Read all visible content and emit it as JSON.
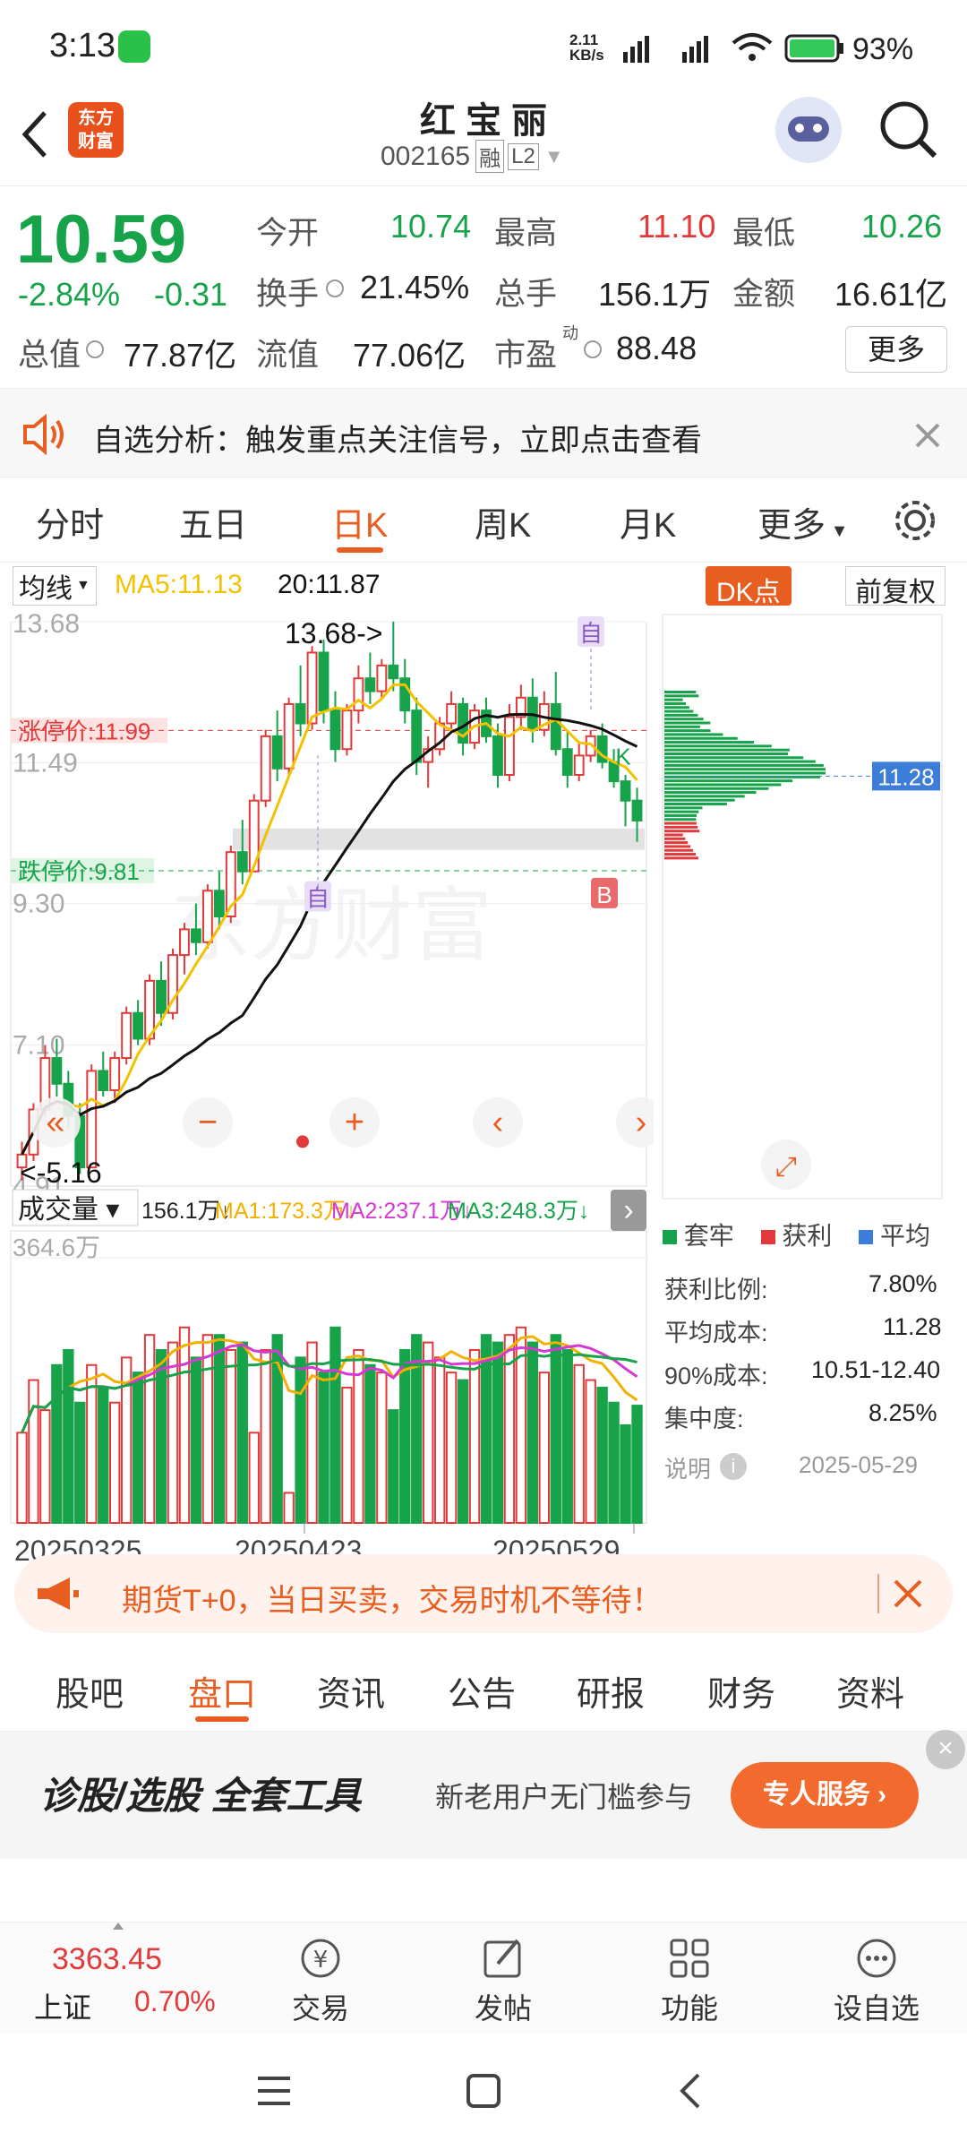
{
  "status_bar": {
    "time": "3:13",
    "net_speed_top": "2.11",
    "net_speed_unit": "KB/s",
    "battery": "93%"
  },
  "header": {
    "logo_line1": "东方",
    "logo_line2": "财富",
    "title": "红 宝 丽",
    "code": "002165",
    "badge1": "融",
    "badge2": "L2"
  },
  "quote": {
    "price": "10.59",
    "change_pct": "-2.84%",
    "change": "-0.31",
    "open_label": "今开",
    "open": "10.74",
    "high_label": "最高",
    "high": "11.10",
    "low_label": "最低",
    "low": "10.26",
    "turnover_label": "换手",
    "turnover": "21.45%",
    "volume_label": "总手",
    "volume": "156.1万",
    "amount_label": "金额",
    "amount": "16.61亿",
    "mktcap_label": "总值",
    "mktcap": "77.87亿",
    "float_label": "流值",
    "float": "77.06亿",
    "pe_label": "市盈",
    "pe_sup": "动",
    "pe": "88.48",
    "more_button": "更多"
  },
  "notice": {
    "text": "自选分析：触发重点关注信号，立即点击查看"
  },
  "tabs": [
    "分时",
    "五日",
    "日K",
    "周K",
    "月K",
    "更多"
  ],
  "active_tab": "日K",
  "chart_toolbar": {
    "ma_select": "均线",
    "ma5": "MA5:11.13",
    "ma20": "20:11.87",
    "dk_button": "DK点",
    "fq_button": "前复权"
  },
  "chart_data": {
    "type": "candlestick",
    "y_ticks": [
      "13.68",
      "11.49",
      "9.30",
      "7.10",
      "4.91"
    ],
    "limit_up_label": "涨停价:11.99",
    "limit_down_label": "跌停价:9.81",
    "max_annotation": "13.68->",
    "min_annotation": "<-5.16",
    "watermark": "东方财富",
    "markers": [
      "自",
      "自",
      "K",
      "B"
    ],
    "ohlc": [
      [
        5.2,
        5.6,
        5.0,
        5.4
      ],
      [
        5.4,
        6.2,
        5.3,
        6.1
      ],
      [
        6.1,
        7.1,
        6.0,
        6.9
      ],
      [
        6.9,
        7.2,
        6.3,
        6.5
      ],
      [
        6.5,
        6.7,
        5.8,
        6.0
      ],
      [
        6.0,
        6.2,
        5.1,
        5.2
      ],
      [
        5.2,
        6.8,
        5.2,
        6.7
      ],
      [
        6.7,
        7.0,
        6.3,
        6.4
      ],
      [
        6.4,
        7.0,
        6.2,
        6.9
      ],
      [
        6.9,
        7.7,
        6.8,
        7.6
      ],
      [
        7.6,
        7.8,
        7.1,
        7.2
      ],
      [
        7.2,
        8.2,
        7.1,
        8.1
      ],
      [
        8.1,
        8.4,
        7.4,
        7.6
      ],
      [
        7.6,
        8.6,
        7.5,
        8.5
      ],
      [
        8.5,
        9.0,
        8.2,
        8.9
      ],
      [
        8.9,
        9.3,
        8.5,
        8.7
      ],
      [
        8.7,
        9.6,
        8.6,
        9.5
      ],
      [
        9.5,
        9.8,
        8.9,
        9.1
      ],
      [
        9.1,
        10.2,
        9.0,
        10.1
      ],
      [
        10.1,
        10.6,
        9.6,
        9.8
      ],
      [
        9.8,
        11.0,
        9.8,
        10.9
      ],
      [
        10.9,
        12.0,
        10.8,
        11.9
      ],
      [
        11.9,
        12.3,
        11.2,
        11.4
      ],
      [
        11.4,
        12.5,
        11.3,
        12.4
      ],
      [
        12.4,
        13.0,
        11.9,
        12.1
      ],
      [
        12.1,
        13.3,
        12.0,
        13.2
      ],
      [
        13.2,
        13.4,
        12.1,
        12.3
      ],
      [
        12.3,
        12.6,
        11.5,
        11.7
      ],
      [
        11.7,
        12.4,
        11.6,
        12.3
      ],
      [
        12.3,
        13.0,
        12.1,
        12.8
      ],
      [
        12.8,
        13.2,
        12.4,
        12.6
      ],
      [
        12.6,
        13.1,
        12.5,
        13.0
      ],
      [
        13.0,
        13.68,
        12.6,
        12.8
      ],
      [
        12.8,
        13.1,
        12.1,
        12.3
      ],
      [
        12.3,
        12.5,
        11.3,
        11.5
      ],
      [
        11.5,
        11.9,
        11.1,
        11.7
      ],
      [
        11.7,
        12.2,
        11.6,
        12.1
      ],
      [
        12.1,
        12.6,
        12.0,
        12.4
      ],
      [
        12.4,
        12.5,
        11.6,
        11.8
      ],
      [
        11.8,
        12.4,
        11.7,
        12.3
      ],
      [
        12.3,
        12.5,
        11.8,
        11.9
      ],
      [
        11.9,
        12.1,
        11.1,
        11.3
      ],
      [
        11.3,
        12.4,
        11.2,
        12.2
      ],
      [
        12.2,
        12.7,
        12.0,
        12.5
      ],
      [
        12.5,
        12.8,
        11.8,
        12.0
      ],
      [
        12.0,
        12.6,
        11.9,
        12.4
      ],
      [
        12.4,
        12.9,
        11.6,
        11.7
      ],
      [
        11.7,
        12.0,
        11.1,
        11.3
      ],
      [
        11.3,
        11.8,
        11.2,
        11.6
      ],
      [
        11.6,
        12.0,
        11.5,
        11.9
      ],
      [
        11.9,
        12.1,
        11.4,
        11.5
      ],
      [
        11.5,
        11.7,
        11.1,
        11.2
      ],
      [
        11.2,
        11.3,
        10.5,
        10.9
      ],
      [
        10.9,
        11.1,
        10.26,
        10.59
      ]
    ],
    "volume_header": {
      "select": "成交量",
      "vol": "156.1万",
      "ma1": "MA1:173.3万",
      "ma2": "MA2:237.1万",
      "ma3": "MA3:248.3万"
    },
    "volume_max_label": "364.6万",
    "dates": [
      "20250325",
      "20250423",
      "20250529"
    ],
    "volume_values": [
      120,
      190,
      150,
      210,
      230,
      160,
      210,
      180,
      160,
      220,
      200,
      250,
      230,
      240,
      260,
      220,
      250,
      250,
      230,
      240,
      120,
      230,
      250,
      40,
      220,
      240,
      200,
      260,
      180,
      230,
      210,
      200,
      150,
      230,
      250,
      240,
      220,
      200,
      190,
      230,
      250,
      240,
      250,
      260,
      240,
      200,
      250,
      230,
      210,
      190,
      180,
      160,
      130,
      156
    ],
    "chip_panel": {
      "avg_price_label": "11.28",
      "legend": [
        "套牢",
        "获利",
        "平均"
      ],
      "profit_ratio_label": "获利比例:",
      "profit_ratio": "7.80%",
      "avg_cost_label": "平均成本:",
      "avg_cost": "11.28",
      "cost90_label": "90%成本:",
      "cost90": "10.51-12.40",
      "concentration_label": "集中度:",
      "concentration": "8.25%",
      "note_label": "说明",
      "date": "2025-05-29"
    }
  },
  "banner": {
    "text": "期货T+0，当日买卖，交易时机不等待！"
  },
  "subtabs": [
    "股吧",
    "盘口",
    "资讯",
    "公告",
    "研报",
    "财务",
    "资料"
  ],
  "active_subtab": "盘口",
  "ad": {
    "slogan": "诊股/选股 全套工具",
    "sub": "新老用户无门槛参与",
    "cta": "专人服务"
  },
  "bottom_nav": {
    "index_value": "3363.45",
    "index_name": "上证",
    "index_pct": "0.70%",
    "items": [
      "交易",
      "发帖",
      "功能",
      "设自选"
    ]
  },
  "colors": {
    "up": "#e23a3a",
    "down": "#16a34a",
    "accent": "#e85d20",
    "ma5": "#f2c200",
    "ma20": "#111111"
  }
}
